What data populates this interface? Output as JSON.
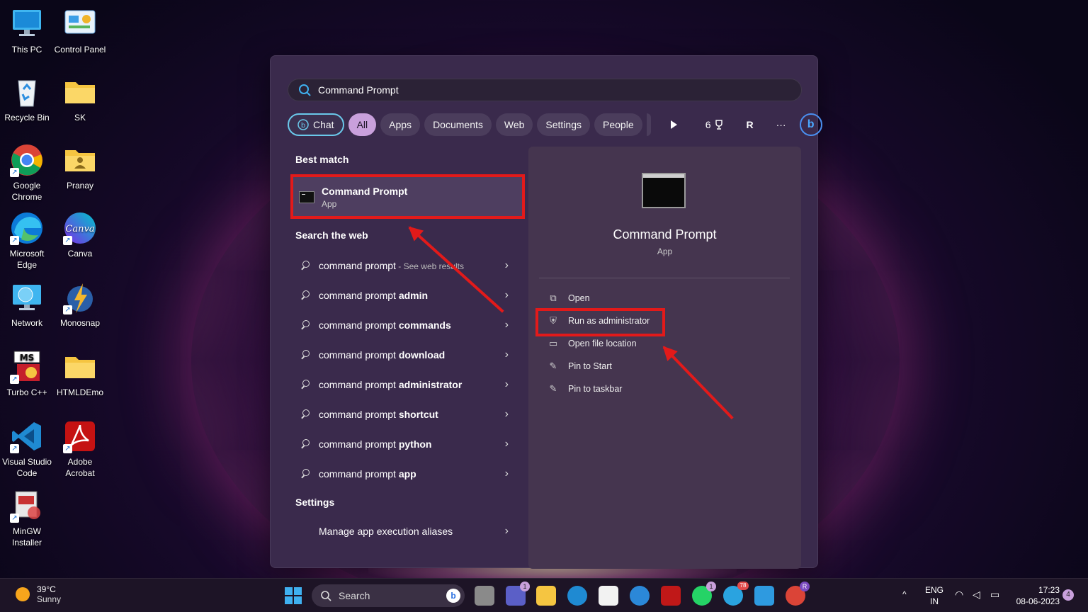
{
  "desktop": {
    "icons": [
      {
        "label": "This PC"
      },
      {
        "label": "Control Panel"
      },
      {
        "label": "Recycle Bin"
      },
      {
        "label": "SK"
      },
      {
        "label": "Google Chrome"
      },
      {
        "label": "Pranay"
      },
      {
        "label": "Microsoft Edge"
      },
      {
        "label": "Canva"
      },
      {
        "label": "Network"
      },
      {
        "label": "Monosnap"
      },
      {
        "label": "Turbo C++"
      },
      {
        "label": "HTMLDEmo"
      },
      {
        "label": "Visual Studio Code"
      },
      {
        "label": "Adobe Acrobat"
      },
      {
        "label": "MinGW Installer"
      }
    ],
    "canva_logo_text": "Canva",
    "turbo_logo_text": "MS"
  },
  "start": {
    "search_query": "Command Prompt",
    "filters": {
      "chat": "Chat",
      "all": "All",
      "apps": "Apps",
      "documents": "Documents",
      "web": "Web",
      "settings": "Settings",
      "people": "People",
      "points": "6",
      "profile": "R",
      "more": "···"
    },
    "best_match_heading": "Best match",
    "best_match": {
      "title": "Command Prompt",
      "type": "App"
    },
    "web_heading": "Search the web",
    "web_results": [
      {
        "query": "command prompt",
        "bold": "",
        "hint": " - See web results"
      },
      {
        "query": "command prompt ",
        "bold": "admin",
        "hint": ""
      },
      {
        "query": "command prompt ",
        "bold": "commands",
        "hint": ""
      },
      {
        "query": "command prompt ",
        "bold": "download",
        "hint": ""
      },
      {
        "query": "command prompt ",
        "bold": "administrator",
        "hint": ""
      },
      {
        "query": "command prompt ",
        "bold": "shortcut",
        "hint": ""
      },
      {
        "query": "command prompt ",
        "bold": "python",
        "hint": ""
      },
      {
        "query": "command prompt ",
        "bold": "app",
        "hint": ""
      }
    ],
    "settings_heading": "Settings",
    "settings_item": "Manage app execution aliases",
    "detail": {
      "title": "Command Prompt",
      "type": "App",
      "actions": [
        "Open",
        "Run as administrator",
        "Open file location",
        "Pin to Start",
        "Pin to taskbar"
      ]
    }
  },
  "taskbar": {
    "temperature": "39°C",
    "condition": "Sunny",
    "search_label": "Search",
    "teams_badge": "1",
    "whatsapp_badge": "1",
    "telegram_badge": "78",
    "chrome_badge": "R",
    "language": "ENG",
    "region": "IN",
    "time": "17:23",
    "date": "08-06-2023",
    "notifications": "4"
  },
  "colors": {
    "highlight": "#e21a1a",
    "accent": "#c9a0dc",
    "panel": "#3a2a4c"
  }
}
